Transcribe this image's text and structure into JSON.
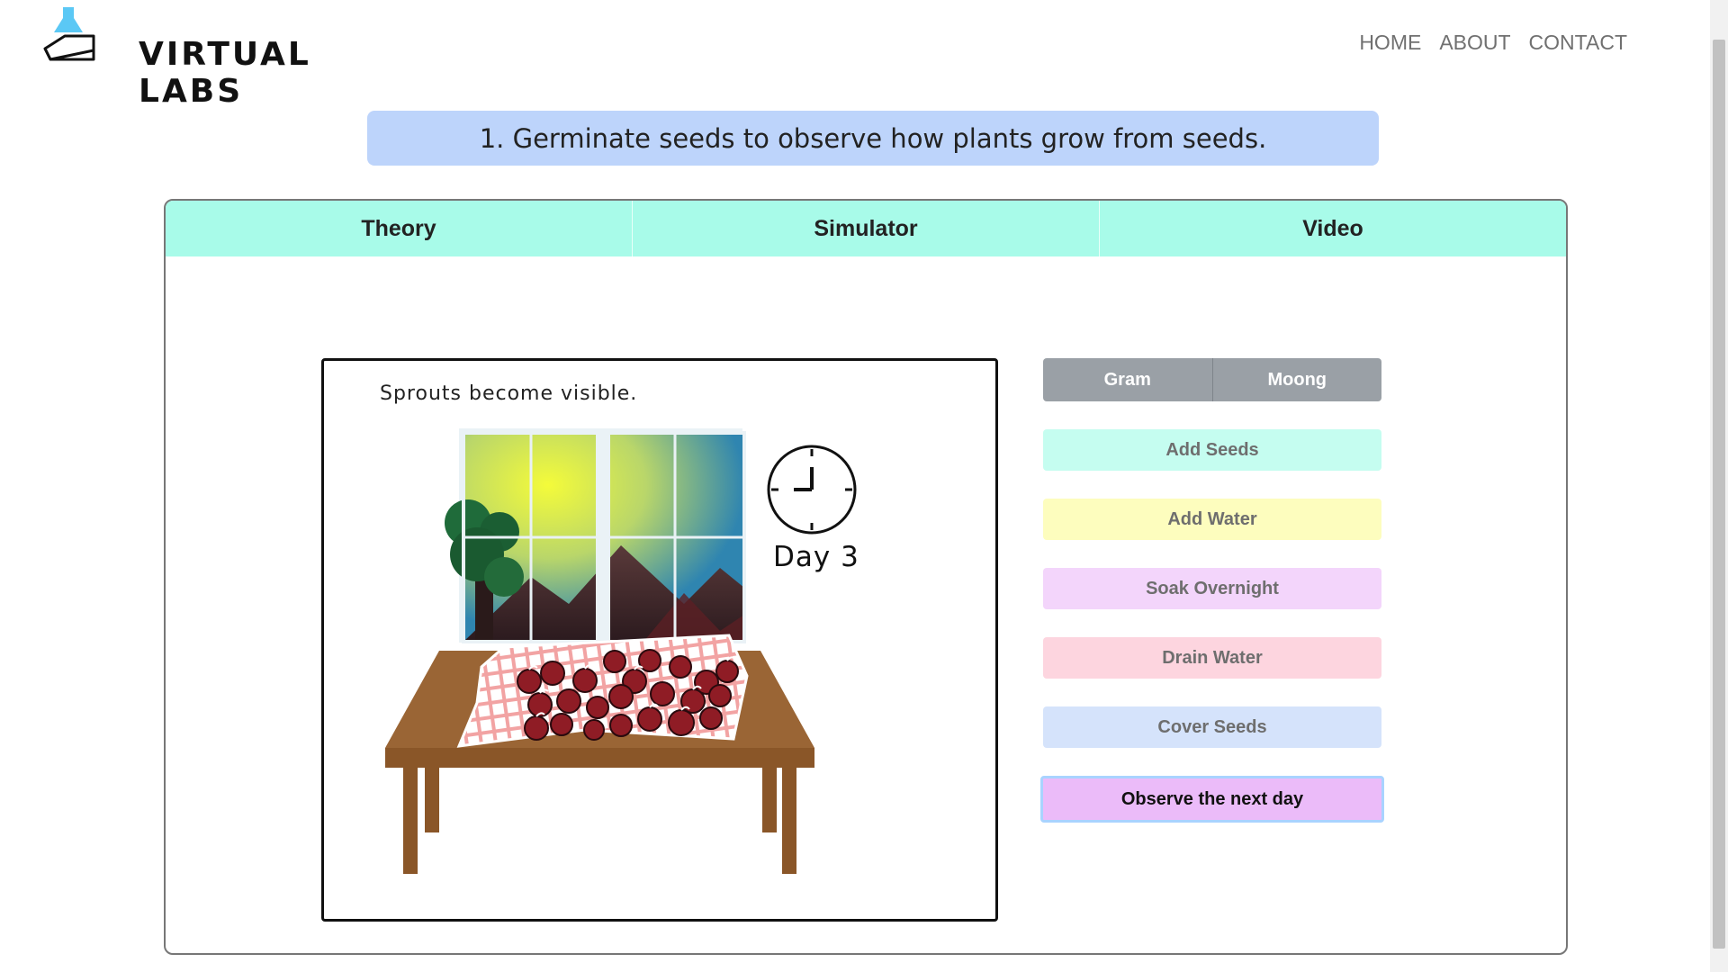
{
  "brand": {
    "name": "VIRTUAL LABS"
  },
  "nav": {
    "home": "HOME",
    "about": "ABOUT",
    "contact": "CONTACT"
  },
  "experiment": {
    "title": "1. Germinate seeds to observe how plants grow from seeds."
  },
  "tabs": [
    {
      "label": "Theory"
    },
    {
      "label": "Simulator"
    },
    {
      "label": "Video"
    }
  ],
  "simulator": {
    "caption": "Sprouts become visible.",
    "day_label": "Day 3"
  },
  "controls": {
    "seed_options": [
      "Gram",
      "Moong"
    ],
    "add_seeds": "Add Seeds",
    "add_water": "Add Water",
    "soak_overnight": "Soak Overnight",
    "drain_water": "Drain Water",
    "cover_seeds": "Cover Seeds",
    "observe_next_day": "Observe the next day"
  },
  "colors": {
    "tab_bg": "#a8fbe9",
    "title_bg": "#bdd4fb",
    "add_seeds_bg": "#c5fdf0",
    "add_water_bg": "#fdfdbe",
    "soak_bg": "#f3d5fb",
    "drain_bg": "#fdd5df",
    "cover_bg": "#d5e3fb",
    "observe_bg": "#ebbbf9"
  }
}
